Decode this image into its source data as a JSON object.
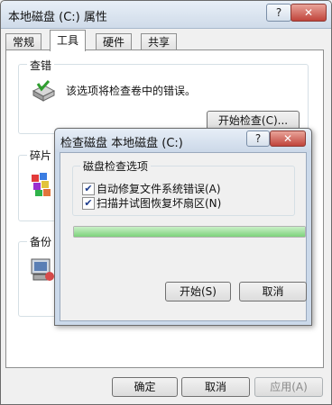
{
  "window": {
    "title": "本地磁盘 (C:) 属性",
    "help": "?",
    "close": "✕"
  },
  "tabs": [
    {
      "label": "常规"
    },
    {
      "label": "工具"
    },
    {
      "label": "硬件"
    },
    {
      "label": "共享"
    }
  ],
  "error_check": {
    "group_label": "查错",
    "description": "该选项将检查卷中的错误。",
    "button": "开始检查(C)..."
  },
  "defrag": {
    "group_label": "碎片"
  },
  "backup": {
    "group_label": "备份"
  },
  "footer": {
    "ok": "确定",
    "cancel": "取消",
    "apply": "应用(A)"
  },
  "dialog": {
    "title": "检查磁盘 本地磁盘 (C:)",
    "help": "?",
    "close": "✕",
    "options_label": "磁盘检查选项",
    "options": [
      {
        "label": "自动修复文件系统错误(A)",
        "checked": true
      },
      {
        "label": "扫描并试图恢复坏扇区(N)",
        "checked": true
      }
    ],
    "progress_fraction": 1.0,
    "start": "开始(S)",
    "cancel": "取消"
  },
  "colors": {
    "progress_green": "#7dd27a",
    "close_red": "#c0443b"
  }
}
